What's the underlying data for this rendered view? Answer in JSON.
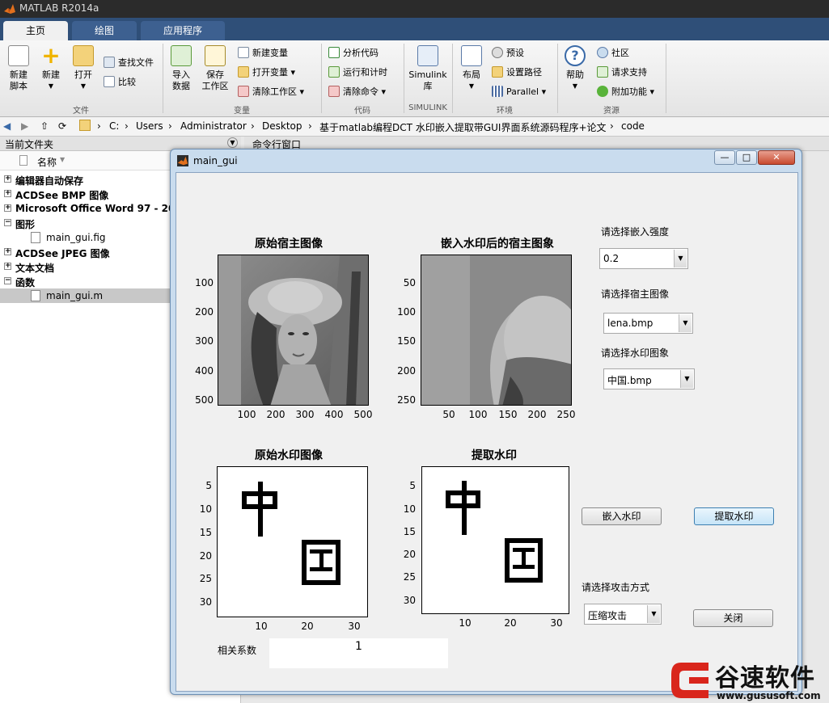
{
  "app": {
    "title": "MATLAB R2014a"
  },
  "tabs": [
    {
      "label": "主页"
    },
    {
      "label": "绘图"
    },
    {
      "label": "应用程序"
    }
  ],
  "ribbon": {
    "new_script": "新建\n脚本",
    "new_script_l1": "新建",
    "new_script_l2": "脚本",
    "new": "新建",
    "open": "打开",
    "find_files": "查找文件",
    "compare": "比较",
    "import_l1": "导入",
    "import_l2": "数据",
    "save_ws_l1": "保存",
    "save_ws_l2": "工作区",
    "new_var": "新建变量",
    "open_var": "打开变量",
    "clear_ws": "清除工作区",
    "analyze_code": "分析代码",
    "run_time": "运行和计时",
    "clear_cmd": "清除命令",
    "simulink_l1": "Simulink",
    "simulink_l2": "库",
    "layout": "布局",
    "prefs": "预设",
    "set_path": "设置路径",
    "parallel": "Parallel",
    "help": "帮助",
    "community": "社区",
    "request_support": "请求支持",
    "addons": "附加功能",
    "groups": {
      "file": "文件",
      "variable": "变量",
      "code": "代码",
      "simulink": "SIMULINK",
      "env": "环境",
      "resources": "资源"
    }
  },
  "address": {
    "crumbs": [
      "C:",
      "Users",
      "Administrator",
      "Desktop",
      "基于matlab编程DCT 水印嵌入提取带GUI界面系统源码程序+论文",
      "code"
    ]
  },
  "current_folder": {
    "header": "当前文件夹",
    "col_name": "名称",
    "rows": [
      {
        "label": "编辑器自动保存",
        "kind": "group"
      },
      {
        "label": "ACDSee BMP 图像",
        "kind": "group"
      },
      {
        "label": "Microsoft Office Word 97 - 200",
        "kind": "group"
      },
      {
        "label": "图形",
        "kind": "group-open"
      },
      {
        "label": "main_gui.fig",
        "kind": "file"
      },
      {
        "label": "ACDSee JPEG 图像",
        "kind": "group"
      },
      {
        "label": "文本文档",
        "kind": "group"
      },
      {
        "label": "函数",
        "kind": "group-open"
      },
      {
        "label": "main_gui.m",
        "kind": "file-selected"
      }
    ]
  },
  "command_window": {
    "header": "命令行窗口"
  },
  "figure": {
    "title": "main_gui",
    "win_buttons": {
      "minimize": "—",
      "maximize": "□",
      "close": "✕"
    },
    "axes": {
      "host": {
        "title": "原始宿主图像",
        "yticks": [
          "100",
          "200",
          "300",
          "400",
          "500"
        ],
        "xticks": [
          "100",
          "200",
          "300",
          "400",
          "500"
        ]
      },
      "embedded": {
        "title": "嵌入水印后的宿主图象",
        "yticks": [
          "50",
          "100",
          "150",
          "200",
          "250"
        ],
        "xticks": [
          "50",
          "100",
          "150",
          "200",
          "250"
        ]
      },
      "watermark": {
        "title": "原始水印图像",
        "yticks": [
          "5",
          "10",
          "15",
          "20",
          "25",
          "30"
        ],
        "xticks": [
          "10",
          "20",
          "30"
        ]
      },
      "extracted": {
        "title": "提取水印",
        "yticks": [
          "5",
          "10",
          "15",
          "20",
          "25",
          "30"
        ],
        "xticks": [
          "10",
          "20",
          "30"
        ]
      }
    },
    "controls": {
      "strength_label": "请选择嵌入强度",
      "strength_value": "0.2",
      "host_label": "请选择宿主图像",
      "host_value": "lena.bmp",
      "wm_label": "请选择水印图象",
      "wm_value": "中国.bmp",
      "embed_button": "嵌入水印",
      "extract_button": "提取水印",
      "attack_label": "请选择攻击方式",
      "attack_value": "压缩攻击",
      "close_button": "关闭",
      "corr_label": "相关系数",
      "corr_value": "1"
    }
  },
  "watermark_logo": {
    "brand": "谷速软件",
    "url": "www.gususoft.com"
  },
  "colors": {
    "tab_bar": "#2f4f78",
    "figure_frame": "#c9dcee",
    "logo_red": "#d9261c"
  }
}
